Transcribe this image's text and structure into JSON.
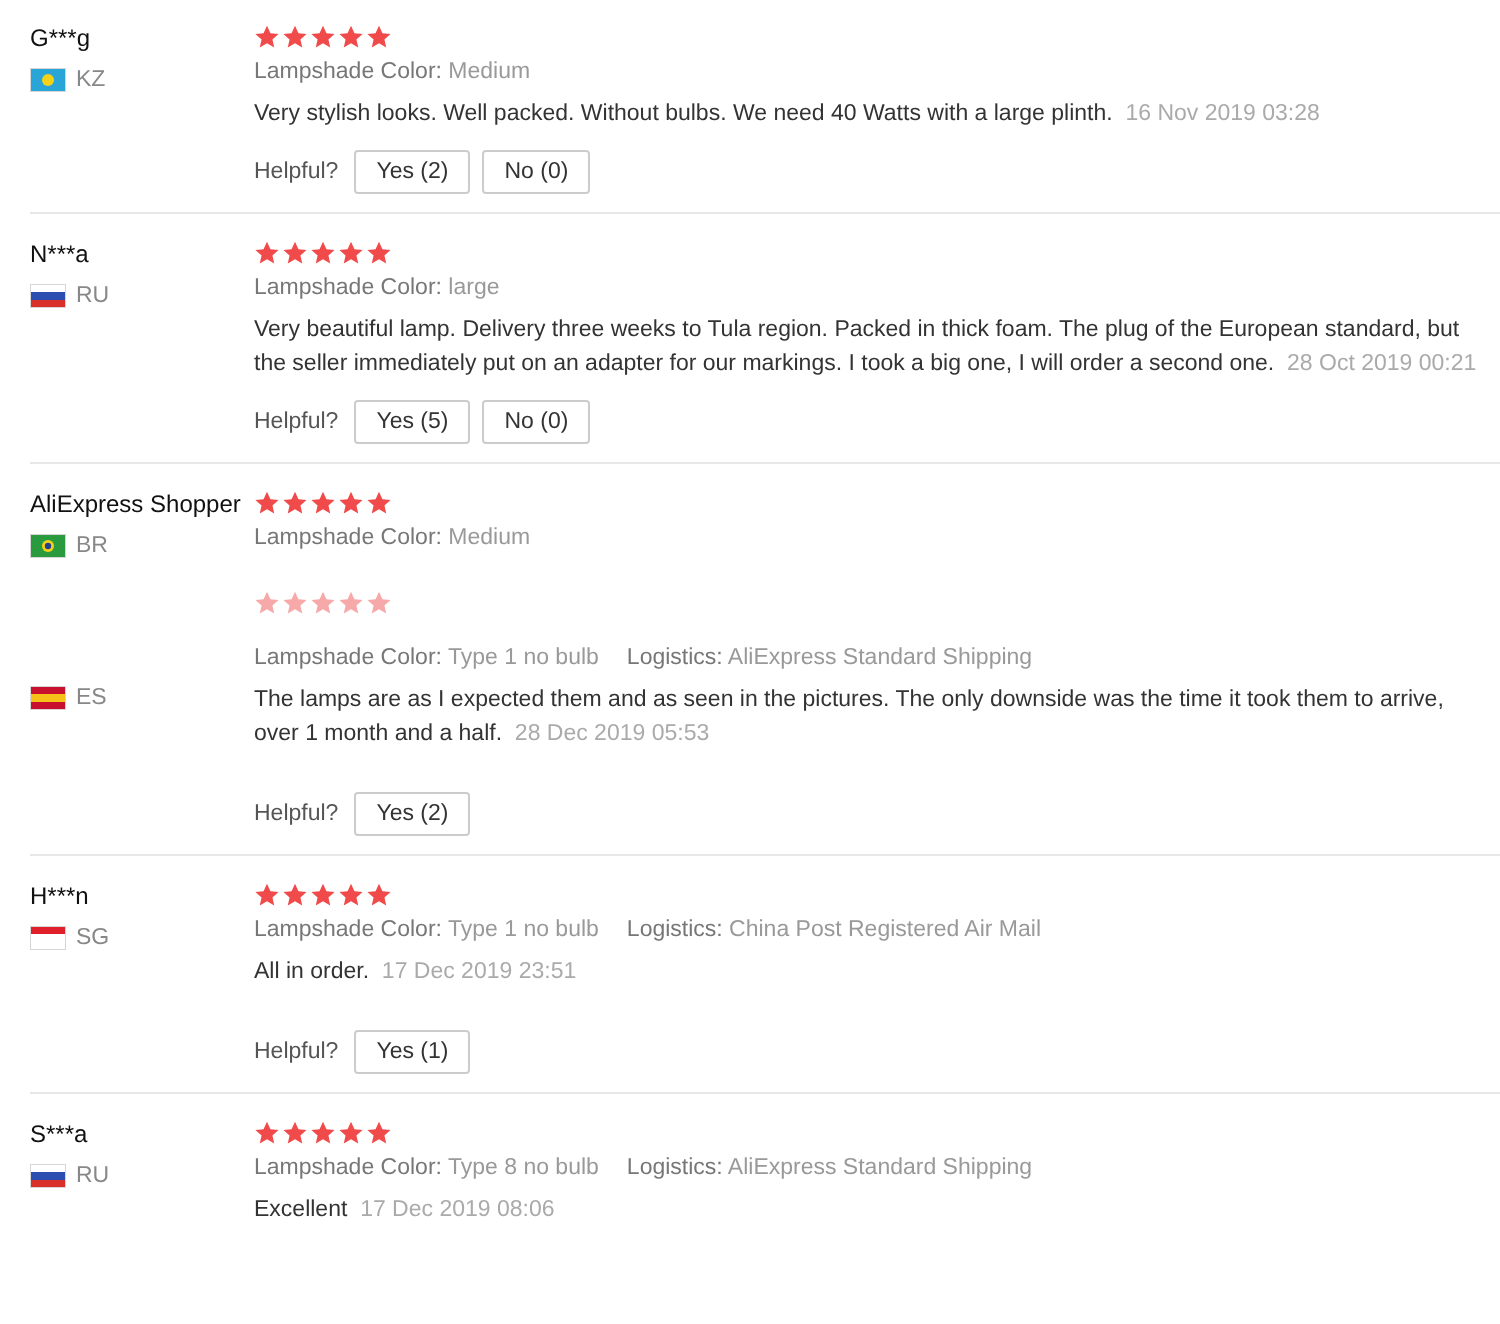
{
  "reviews": [
    {
      "name": "G***g",
      "flag": {
        "kind": "kz"
      },
      "country": "KZ",
      "stars": 5,
      "faded_stars": false,
      "attributes": [
        {
          "label": "Lampshade Color:",
          "value": "Medium"
        }
      ],
      "comment": "Very stylish looks. Well packed. Without bulbs. We need 40 Watts with a large plinth.",
      "date": "16 Nov 2019 03:28",
      "helpful": {
        "label": "Helpful?",
        "buttons": [
          "Yes (2)",
          "No (0)"
        ]
      },
      "divider_after": true
    },
    {
      "name": "N***a",
      "flag": {
        "kind": "ru"
      },
      "country": "RU",
      "stars": 5,
      "faded_stars": false,
      "attributes": [
        {
          "label": "Lampshade Color:",
          "value": "large"
        }
      ],
      "comment": "Very beautiful lamp. Delivery three weeks to Tula region. Packed in thick foam. The plug of the European standard, but the seller immediately put on an adapter for our markings. I took a big one, I will order a second one.",
      "date": "28 Oct 2019 00:21",
      "helpful": {
        "label": "Helpful?",
        "buttons": [
          "Yes (5)",
          "No (0)"
        ]
      },
      "divider_after": true
    },
    {
      "name": "AliExpress Shopper",
      "flag": {
        "kind": "br"
      },
      "country": "BR",
      "stars": 5,
      "faded_stars": false,
      "attributes": [
        {
          "label": "Lampshade Color:",
          "value": "Medium"
        }
      ],
      "divider_after": false
    },
    {
      "flag": {
        "kind": "es"
      },
      "country": "ES",
      "stars": 5,
      "faded_stars": true,
      "attributes": [
        {
          "label": "Lampshade Color:",
          "value": "Type 1 no bulb"
        },
        {
          "label": "Logistics:",
          "value": "AliExpress Standard Shipping"
        }
      ],
      "comment": "The lamps are as I expected them and as seen in the pictures. The only downside was the time it took them to arrive, over 1 month and a half.",
      "date": "28 Dec 2019 05:53",
      "helpful": {
        "label": "Helpful?",
        "buttons": [
          "Yes (2)"
        ]
      },
      "divider_after": true
    },
    {
      "name": "H***n",
      "flag": {
        "kind": "sg"
      },
      "country": "SG",
      "stars": 5,
      "faded_stars": false,
      "attributes": [
        {
          "label": "Lampshade Color:",
          "value": "Type 1 no bulb"
        },
        {
          "label": "Logistics:",
          "value": "China Post Registered Air Mail"
        }
      ],
      "comment": "All in order.",
      "date": "17 Dec 2019 23:51",
      "helpful": {
        "label": "Helpful?",
        "buttons": [
          "Yes (1)"
        ]
      },
      "divider_after": true
    },
    {
      "name": "S***a",
      "flag": {
        "kind": "ru"
      },
      "country": "RU",
      "stars": 5,
      "faded_stars": false,
      "attributes": [
        {
          "label": "Lampshade Color:",
          "value": "Type 8 no bulb"
        },
        {
          "label": "Logistics:",
          "value": "AliExpress Standard Shipping"
        }
      ],
      "comment": "Excellent",
      "date": "17 Dec 2019 08:06",
      "divider_after": false
    }
  ]
}
